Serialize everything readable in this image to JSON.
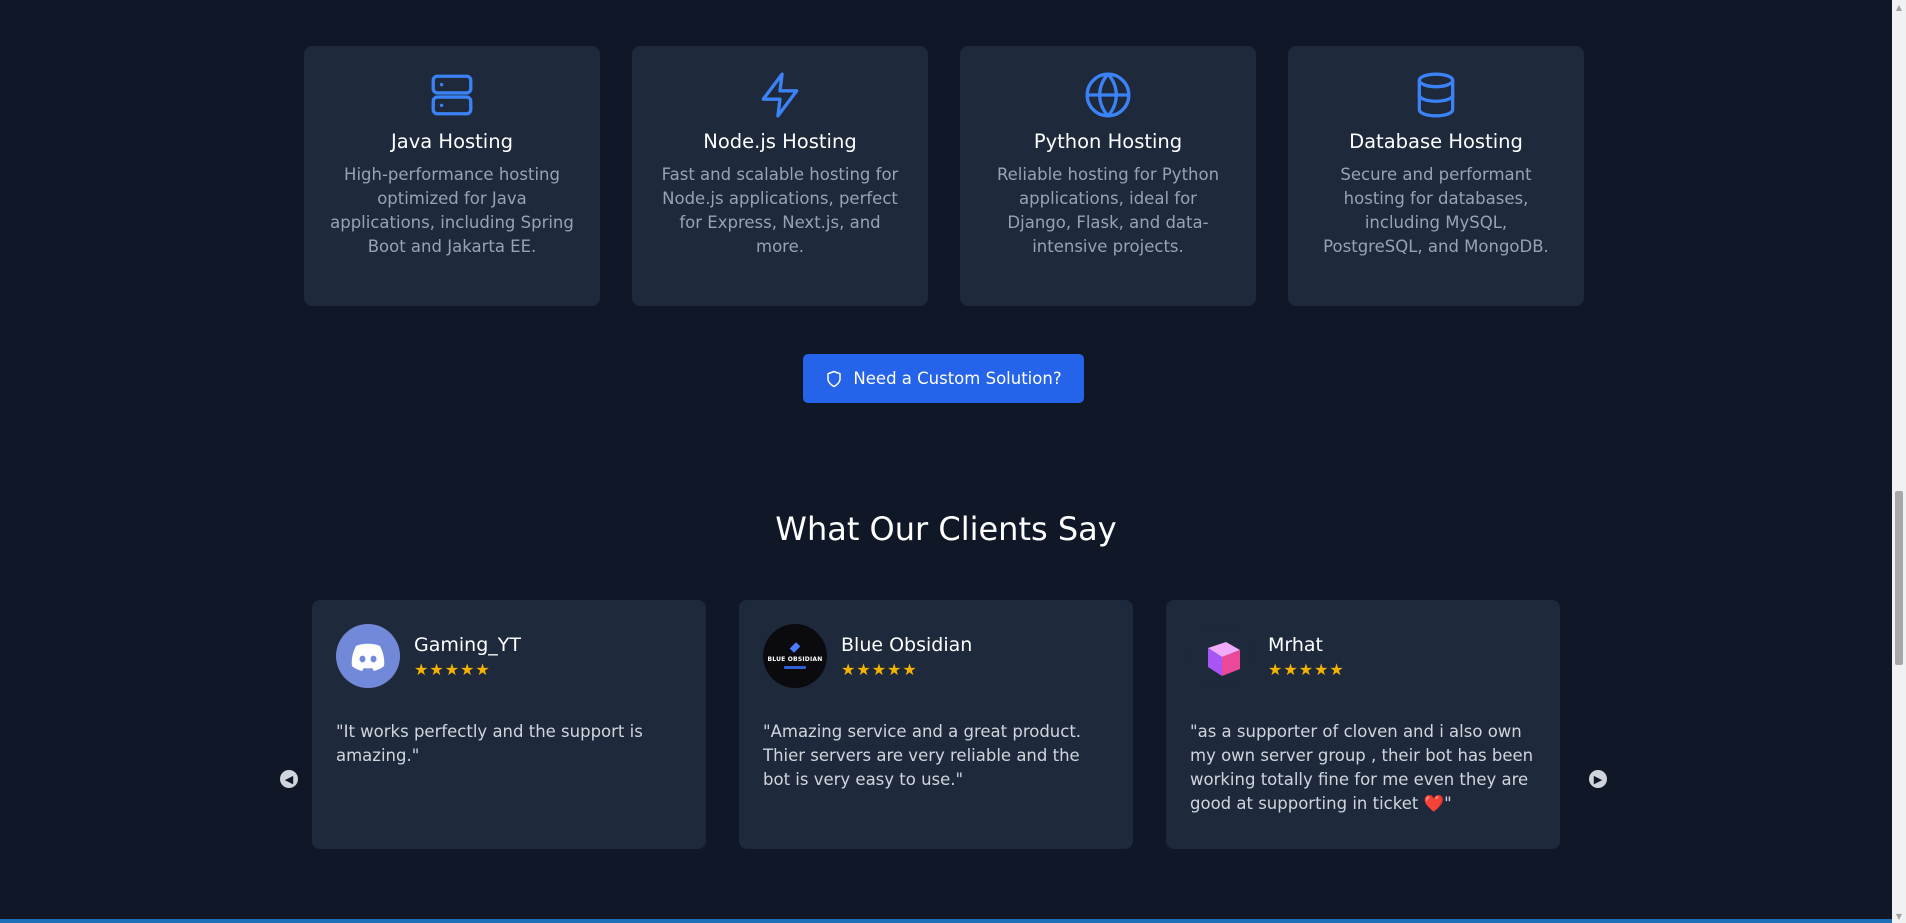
{
  "services": [
    {
      "icon": "server-icon",
      "title": "Java Hosting",
      "description": "High-performance hosting optimized for Java applications, including Spring Boot and Jakarta EE."
    },
    {
      "icon": "lightning-icon",
      "title": "Node.js Hosting",
      "description": "Fast and scalable hosting for Node.js applications, perfect for Express, Next.js, and more."
    },
    {
      "icon": "globe-icon",
      "title": "Python Hosting",
      "description": "Reliable hosting for Python applications, ideal for Django, Flask, and data-intensive projects."
    },
    {
      "icon": "database-icon",
      "title": "Database Hosting",
      "description": "Secure and performant hosting for databases, including MySQL, PostgreSQL, and MongoDB."
    }
  ],
  "cta": {
    "label": "Need a Custom Solution?",
    "icon": "shield-icon"
  },
  "testimonials_section": {
    "title": "What Our Clients Say",
    "items": [
      {
        "name": "Gaming_YT",
        "stars": "★★★★★",
        "text": "\"It works perfectly and the support is amazing.\"",
        "avatar": "discord-avatar"
      },
      {
        "name": "Blue Obsidian",
        "stars": "★★★★★",
        "text": "\"Amazing service and a great product. Thier servers are very reliable and the bot is very easy to use.\"",
        "avatar": "blue-obsidian-avatar",
        "avatar_text": "BLUE OBSIDIAN"
      },
      {
        "name": "Mrhat",
        "stars": "★★★★★",
        "text": "\"as a supporter of cloven and i also own my own server group , their bot has been working totally fine for me even they are good at supporting in ticket ❤️\"",
        "avatar": "cube-avatar"
      }
    ],
    "prev_icon": "arrow-left-circle-icon",
    "next_icon": "arrow-right-circle-icon"
  },
  "colors": {
    "background": "#101828",
    "card": "#1e293b",
    "accent": "#2563eb",
    "star": "#f5b301",
    "icon": "#3b82f6"
  }
}
